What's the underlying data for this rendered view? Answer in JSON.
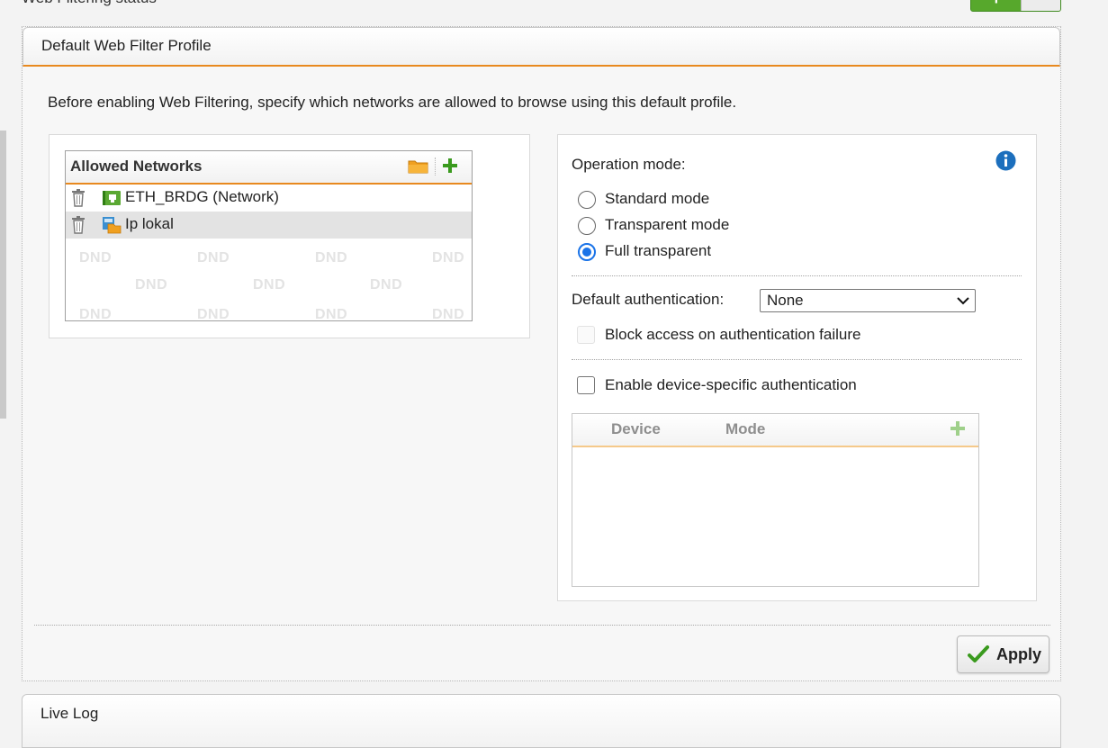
{
  "top": {
    "status_label": "Web Filtering status",
    "toggle_symbol": "+"
  },
  "panel": {
    "title": "Default Web Filter Profile",
    "intro": "Before enabling Web Filtering, specify which networks are allowed to browse using this default profile."
  },
  "allowed_networks": {
    "header": "Allowed Networks",
    "rows": [
      {
        "label": "ETH_BRDG (Network)",
        "icon": "network-icon"
      },
      {
        "label": "Ip lokal",
        "icon": "ip-object-icon"
      }
    ],
    "dnd_watermark": "DND"
  },
  "settings": {
    "operation_mode_label": "Operation mode:",
    "modes": [
      {
        "label": "Standard mode",
        "selected": false
      },
      {
        "label": "Transparent mode",
        "selected": false
      },
      {
        "label": "Full transparent",
        "selected": true
      }
    ],
    "default_auth_label": "Default authentication:",
    "default_auth_value": "None",
    "block_access_label": "Block access on authentication failure",
    "device_auth_label": "Enable device-specific authentication",
    "device_table": {
      "col_device": "Device",
      "col_mode": "Mode"
    }
  },
  "apply_label": "Apply",
  "live_log_title": "Live Log",
  "colors": {
    "accent": "#e8891f",
    "primary_blue": "#1a73e8",
    "green": "#57a82c"
  }
}
